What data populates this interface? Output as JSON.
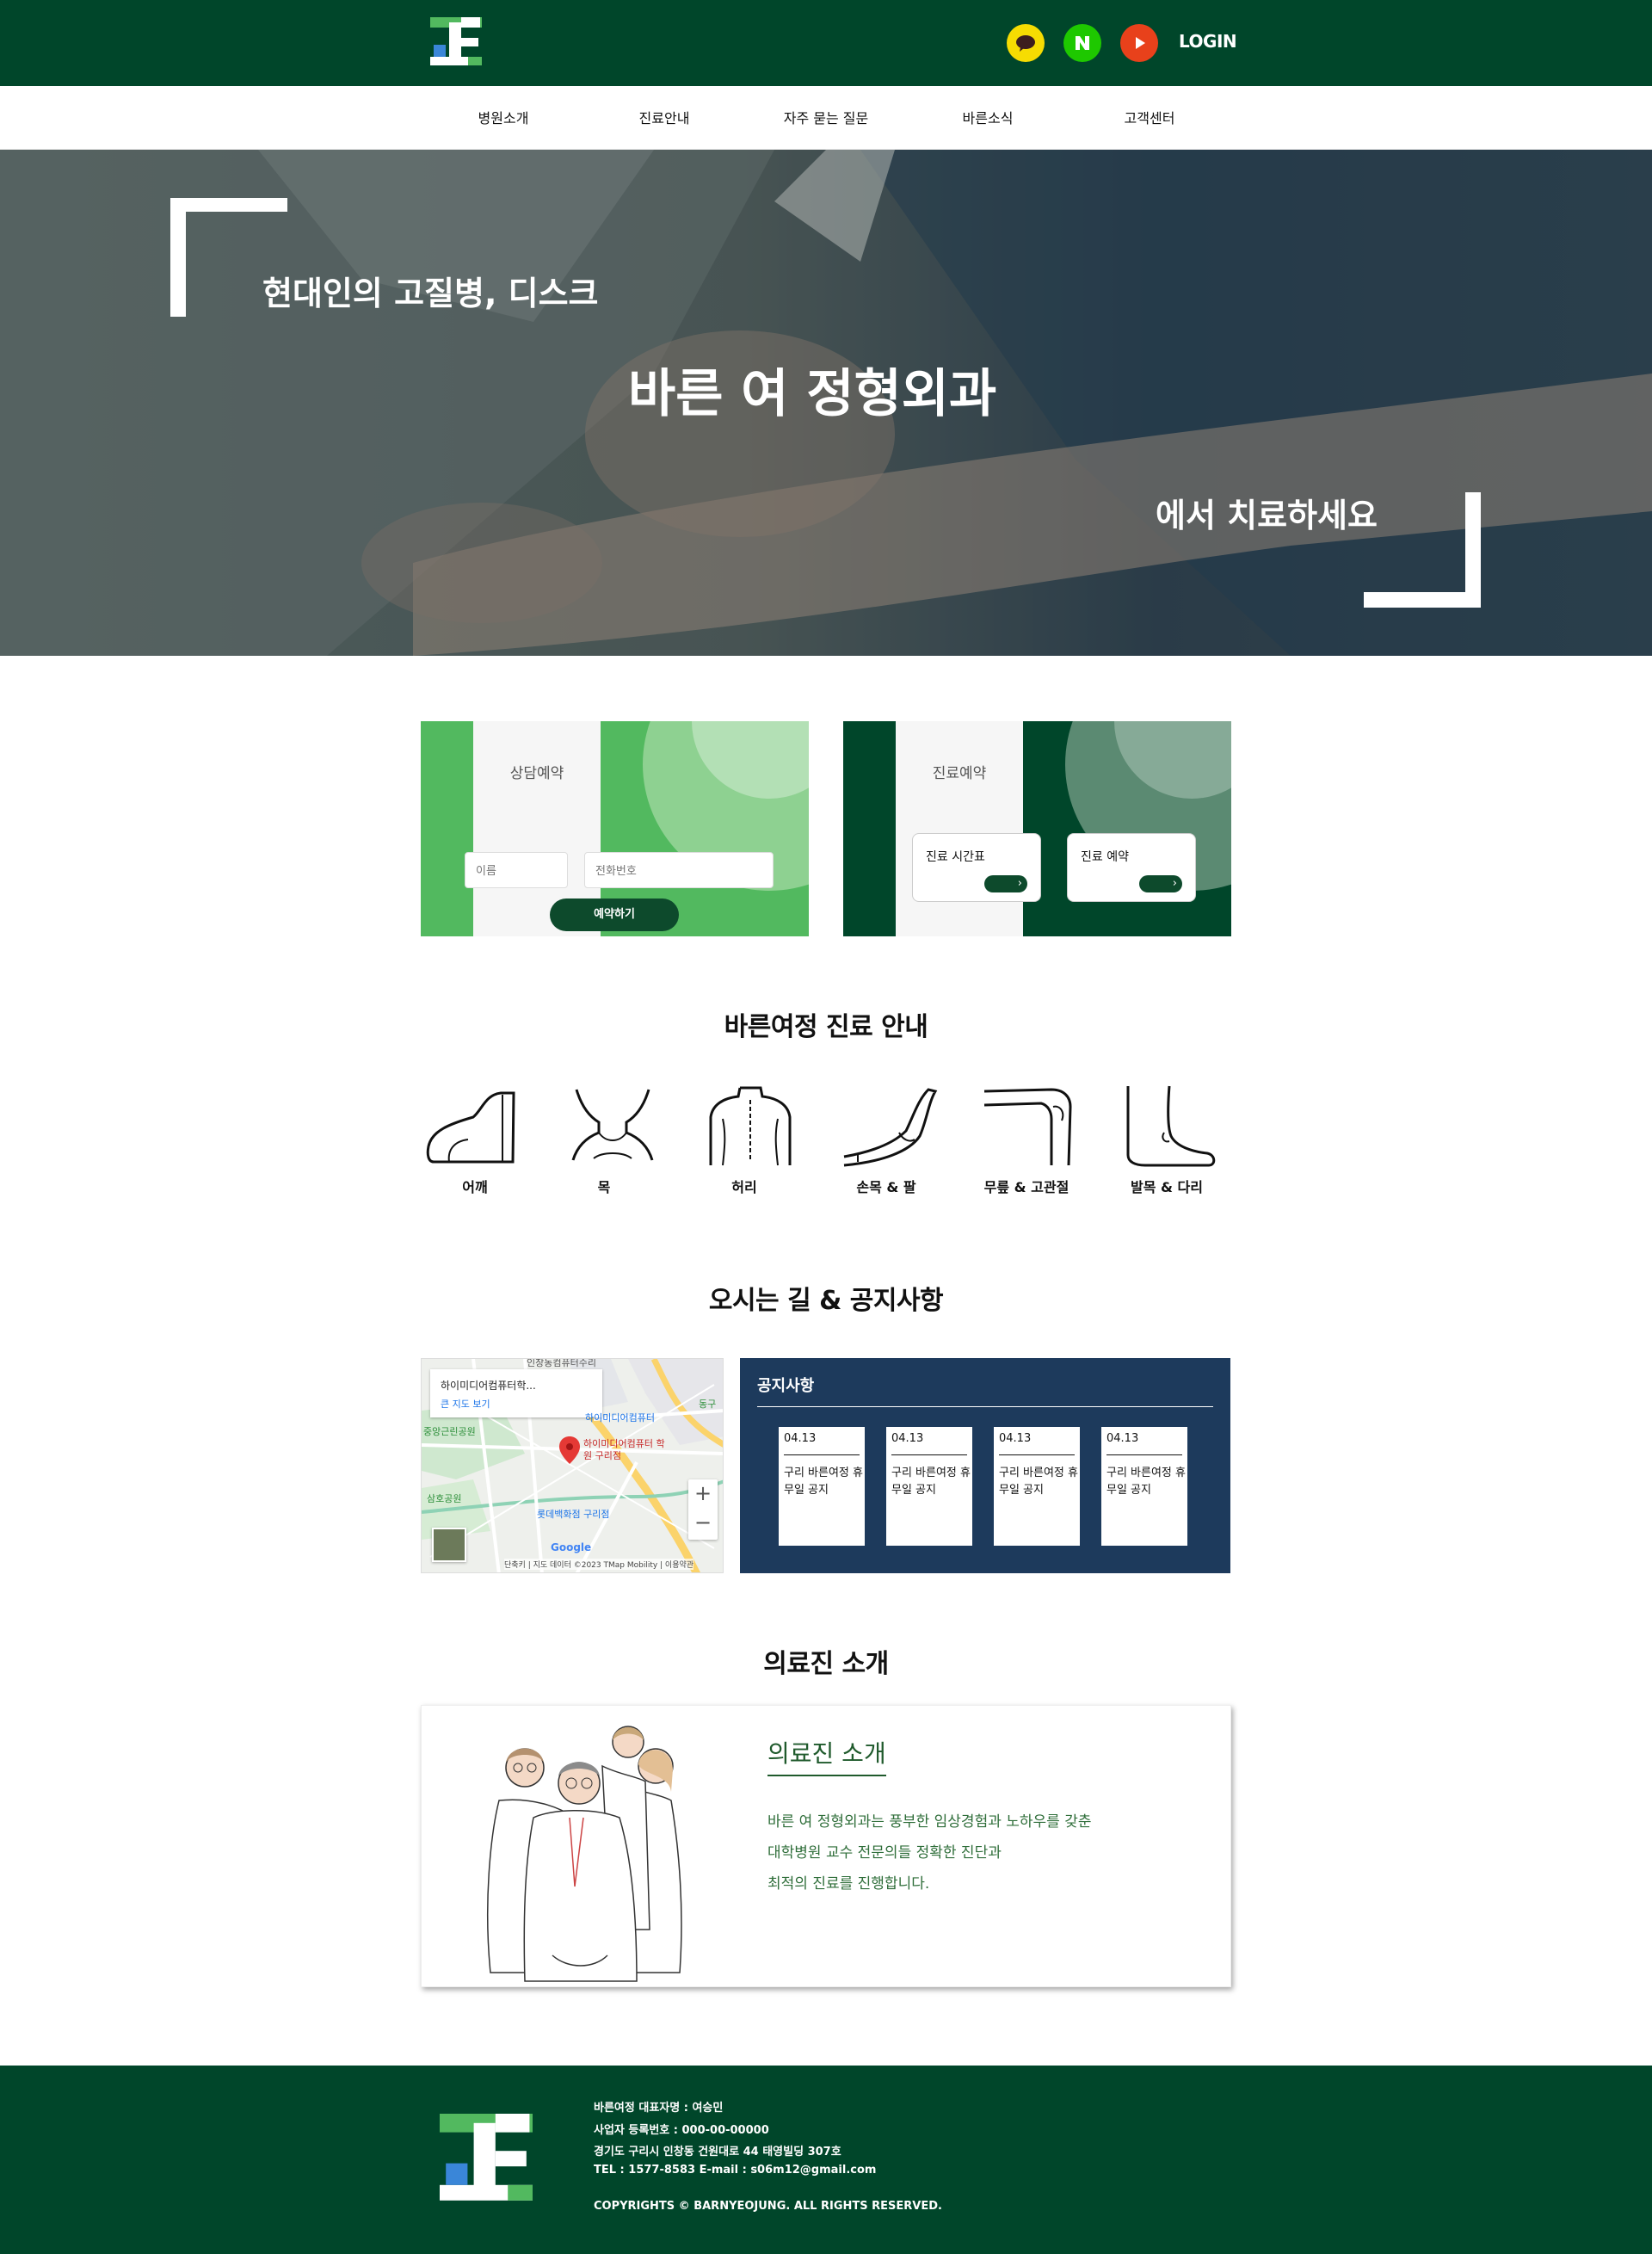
{
  "header": {
    "login_label": "LOGIN",
    "social": [
      "kakao-icon",
      "naver-icon",
      "youtube-icon"
    ],
    "colors": {
      "brand": "#00462a",
      "kakao": "#f6dc02",
      "naver": "#1ec800",
      "youtube": "#e8411b"
    }
  },
  "nav": {
    "items": [
      "병원소개",
      "진료안내",
      "자주 묻는 질문",
      "바른소식",
      "고객센터"
    ]
  },
  "hero": {
    "line1": "현대인의 고질병, 디스크",
    "line2": "바른 여 정형외과",
    "line3": "에서 치료하세요"
  },
  "consult": {
    "title": "상담예약",
    "name_placeholder": "이름",
    "phone_placeholder": "전화번호",
    "submit_label": "예약하기",
    "colors": {
      "green": "#52b95f",
      "light": "#8ed191"
    }
  },
  "reserve": {
    "title": "진료예약",
    "schedule_label": "진료 시간표",
    "booking_label": "진료 예약",
    "colors": {
      "dark": "#00462a"
    }
  },
  "treatment": {
    "title": "바른여정 진료 안내",
    "items": [
      {
        "label": "어깨",
        "icon": "shoulder-icon"
      },
      {
        "label": "목",
        "icon": "neck-icon"
      },
      {
        "label": "허리",
        "icon": "back-icon"
      },
      {
        "label": "손목 & 팔",
        "icon": "wrist-arm-icon"
      },
      {
        "label": "무릎 & 고관절",
        "icon": "knee-hip-icon"
      },
      {
        "label": "발목 & 다리",
        "icon": "ankle-leg-icon"
      }
    ]
  },
  "location": {
    "title": "오시는 길 & 공지사항",
    "map": {
      "place_name": "하이미디어컴퓨터학...",
      "bigger_map": "큰 지도 보기",
      "labels": {
        "top": "인창동컴퓨터수리",
        "park1": "중앙근린공원",
        "school": "하이미디어컴퓨터",
        "pin": "하이미디어컴퓨터 학원 구리점",
        "park2": "삼호공원",
        "store": "롯데백화점 구리점",
        "edge": "동구",
        "google": "Google",
        "attribution": "단축키 | 지도 데이터 ©2023 TMap Mobility | 이용약관"
      },
      "zoom_in": "+",
      "zoom_out": "−"
    },
    "notice": {
      "title": "공지사항",
      "items": [
        {
          "date": "04.13",
          "text": "구리 바른여정 휴무일 공지"
        },
        {
          "date": "04.13",
          "text": "구리 바른여정 휴무일 공지"
        },
        {
          "date": "04.13",
          "text": "구리 바른여정 휴무일 공지"
        },
        {
          "date": "04.13",
          "text": "구리 바른여정 휴무일 공지"
        }
      ],
      "colors": {
        "bg": "#1d3a5c"
      }
    }
  },
  "doctors": {
    "section_title": "의료진 소개",
    "box_title": "의료진 소개",
    "lines": [
      "바른 여 정형외과는 풍부한 임상경험과 노하우를 갖춘",
      "대학병원 교수 전문의들 정확한 진단과",
      "최적의 진료를 진행합니다."
    ],
    "colors": {
      "text": "#2f6e3a"
    }
  },
  "footer": {
    "lines": [
      "바른여정 대표자명 : 여승민",
      "사업자 등록번호 : 000-00-00000",
      "경기도 구리시 인창동 건원대로 44 태영빌딩 307호",
      "TEL : 1577-8583 E-mail : s06m12@gmail.com"
    ],
    "copyright": "COPYRIGHTS © BARNYEOJUNG. ALL RIGHTS RESERVED."
  }
}
